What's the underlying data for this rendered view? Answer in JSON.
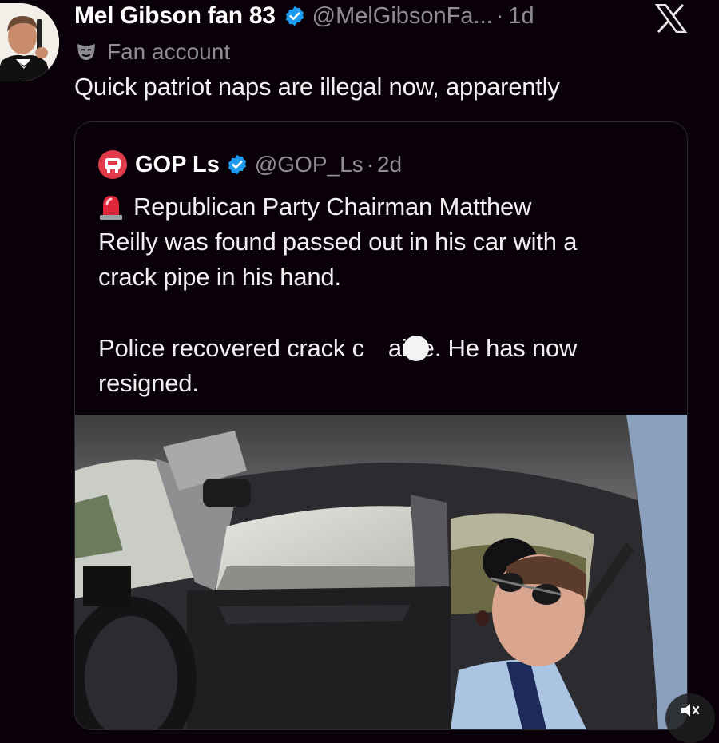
{
  "post": {
    "display_name": "Mel Gibson fan 83",
    "handle": "@MelGibsonFa...",
    "separator": "·",
    "time": "1d",
    "fan_label": "Fan account",
    "text": "Quick patriot naps are illegal now, apparently"
  },
  "quote": {
    "display_name": "GOP Ls",
    "handle": "@GOP_Ls",
    "separator": "·",
    "time": "2d",
    "lines": [
      "Republican Party Chairman Matthew",
      "Reilly was found passed out in his car with a",
      "crack pipe in his hand.",
      "Police recovered crack c",
      "aine. He has now",
      "resigned."
    ]
  },
  "icons": {
    "verified": "verified-badge-icon",
    "x_logo": "x-logo-icon",
    "mask": "theater-mask-icon",
    "siren": "siren-emoji-icon",
    "gop": "gop-logo-icon",
    "mute": "speaker-muted-icon"
  },
  "colors": {
    "background": "#0a0009",
    "verified_blue": "#1d9bf0",
    "secondary_text": "#8f8d94",
    "gop_red": "#e23a4b"
  }
}
